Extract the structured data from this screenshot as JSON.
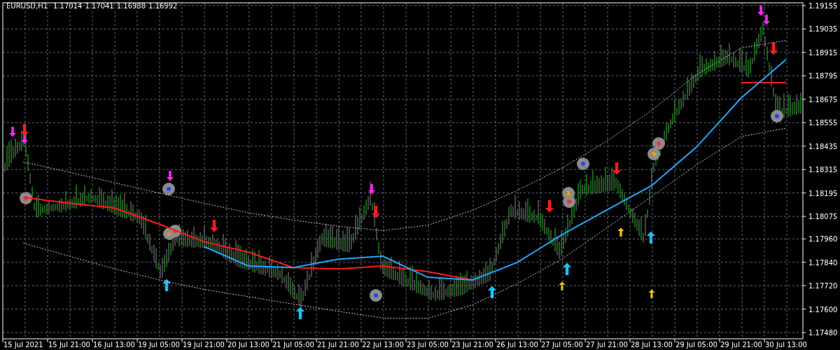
{
  "header": {
    "symbol": "EURUSD,H1",
    "quotes": [
      "1.17014",
      "1.17041",
      "1.16988",
      "1.16992"
    ]
  },
  "chart": {
    "chart_data": {
      "type": "line",
      "categories": [
        "15 Jul 2021",
        "15 Jul 21:00",
        "16 Jul 13:00",
        "19 Jul 05:00",
        "19 Jul 21:00",
        "20 Jul 13:00",
        "21 Jul 05:00",
        "21 Jul 21:00",
        "22 Jul 13:00",
        "23 Jul 05:00",
        "23 Jul 21:00",
        "26 Jul 13:00",
        "27 Jul 05:00",
        "27 Jul 21:00",
        "28 Jul 13:00",
        "29 Jul 05:00",
        "29 Jul 21:00",
        "30 Jul 13:00"
      ],
      "series": [
        {
          "color": "#ff1a1a",
          "values": [
            1.18172,
            1.18143,
            1.18118,
            1.18036,
            1.17946,
            1.17892,
            1.17813,
            1.17806,
            1.17821,
            1.17792,
            1.17749,
            null,
            null,
            null,
            null,
            null,
            1.1876,
            1.1876
          ]
        },
        {
          "color": "#1ea7ff",
          "values": [
            null,
            null,
            null,
            null,
            1.17921,
            1.17821,
            1.17813,
            1.17856,
            1.17871,
            1.17763,
            1.17749,
            1.17839,
            1.17982,
            1.18108,
            1.18233,
            1.1843,
            1.18682,
            1.18879
          ]
        },
        {
          "color": "#c8c8c8",
          "line_style": "dashed",
          "values": [
            1.18354,
            1.18301,
            1.18248,
            1.18195,
            1.18142,
            1.18094,
            1.18056,
            1.18025,
            1.18002,
            1.1803,
            1.18106,
            1.18208,
            1.18323,
            1.18461,
            1.18618,
            1.18802,
            1.18938,
            1.18976
          ]
        },
        {
          "color": "#c8c8c8",
          "line_style": "dashed",
          "values": [
            1.17938,
            1.17871,
            1.17807,
            1.17751,
            1.17701,
            1.17664,
            1.17626,
            1.17589,
            1.17554,
            1.17553,
            1.17622,
            1.17731,
            1.17857,
            1.18016,
            1.18177,
            1.18339,
            1.18484,
            1.18527
          ]
        }
      ],
      "ylim": [
        1.17448,
        1.19169
      ],
      "grid": true,
      "yticks": [
        {
          "value": 1.19155,
          "label": "1.19155"
        },
        {
          "value": 1.19035,
          "label": "1.19035"
        },
        {
          "value": 1.18915,
          "label": "1.18915"
        },
        {
          "value": 1.18795,
          "label": "1.18795"
        },
        {
          "value": 1.18675,
          "label": "1.18675"
        },
        {
          "value": 1.18555,
          "label": "1.18555"
        },
        {
          "value": 1.18435,
          "label": "1.18435"
        },
        {
          "value": 1.18315,
          "label": "1.18315"
        },
        {
          "value": 1.18195,
          "label": "1.18195"
        },
        {
          "value": 1.18075,
          "label": "1.18075"
        },
        {
          "value": 1.1796,
          "label": "1.17960"
        },
        {
          "value": 1.1784,
          "label": "1.17840"
        },
        {
          "value": 1.1772,
          "label": "1.17720"
        },
        {
          "value": 1.176,
          "label": "1.17600"
        },
        {
          "value": 1.1748,
          "label": "1.17480"
        }
      ]
    }
  }
}
